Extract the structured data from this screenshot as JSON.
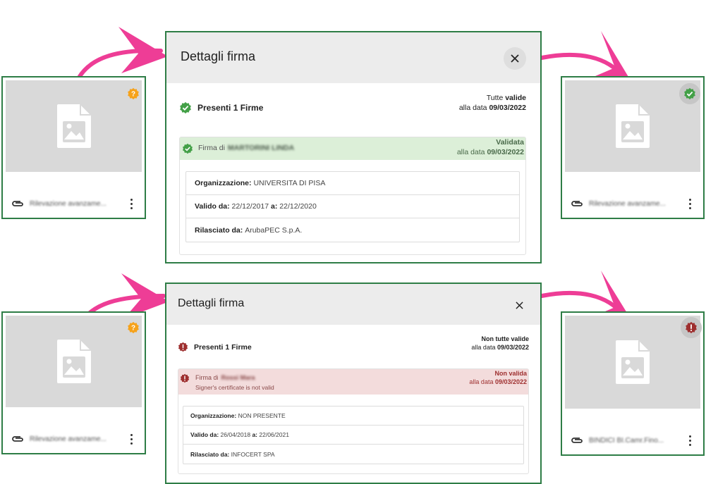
{
  "cards": [
    {
      "file_name": "Rilevazione avanzame...",
      "badge": "pending"
    },
    {
      "file_name": "Rilevazione avanzame...",
      "badge": "valid"
    },
    {
      "file_name": "Rilevazione avanzame...",
      "badge": "pending"
    },
    {
      "file_name": "BINDICI BI.Camr.Fino...",
      "badge": "invalid"
    }
  ],
  "icons": {
    "file": "image-file-icon",
    "attachment": "paperclip-icon",
    "menu": "more-vert-icon",
    "close": "close-icon",
    "valid": "verified-check-icon",
    "invalid": "alert-seal-icon",
    "pending": "question-seal-icon"
  },
  "colors": {
    "card_border": "#2e7d46",
    "arrow": "#ee3d96",
    "valid_green": "#43a047",
    "valid_bg": "#dcefd8",
    "invalid_red": "#9e2f2f",
    "invalid_bg": "#f3dcdc",
    "pending_orange": "#f6a21a"
  },
  "dialog_valid": {
    "title": "Dettagli firma",
    "summary": "Presenti 1 Firme",
    "status_prefix": "Tutte ",
    "status_word": "valide",
    "date_prefix": "alla data ",
    "date": "09/03/2022",
    "signer_prefix": "Firma di",
    "signer_name": "MARTORINI LINDA",
    "sig_status": "Validata",
    "sig_date_prefix": "alla data ",
    "sig_date": "09/03/2022",
    "org_label": "Organizzazione:",
    "org_value": "UNIVERSITA DI PISA",
    "valid_from_label": "Valido da:",
    "valid_from": "22/12/2017",
    "valid_to_label": "a:",
    "valid_to": "22/12/2020",
    "issuer_label": "Rilasciato da:",
    "issuer": "ArubaPEC S.p.A."
  },
  "dialog_invalid": {
    "title": "Dettagli firma",
    "summary": "Presenti 1 Firme",
    "status": "Non tutte valide",
    "date_prefix": "alla data ",
    "date": "09/03/2022",
    "signer_prefix": "Firma di",
    "signer_name": "Rossi Mara",
    "signer_note": "Signer's certificate is not valid",
    "sig_status": "Non valida",
    "sig_date_prefix": "alla data ",
    "sig_date": "09/03/2022",
    "org_label": "Organizzazione:",
    "org_value": "NON PRESENTE",
    "valid_from_label": "Valido da:",
    "valid_from": "26/04/2018",
    "valid_to_label": "a:",
    "valid_to": "22/06/2021",
    "issuer_label": "Rilasciato da:",
    "issuer": "INFOCERT SPA"
  }
}
